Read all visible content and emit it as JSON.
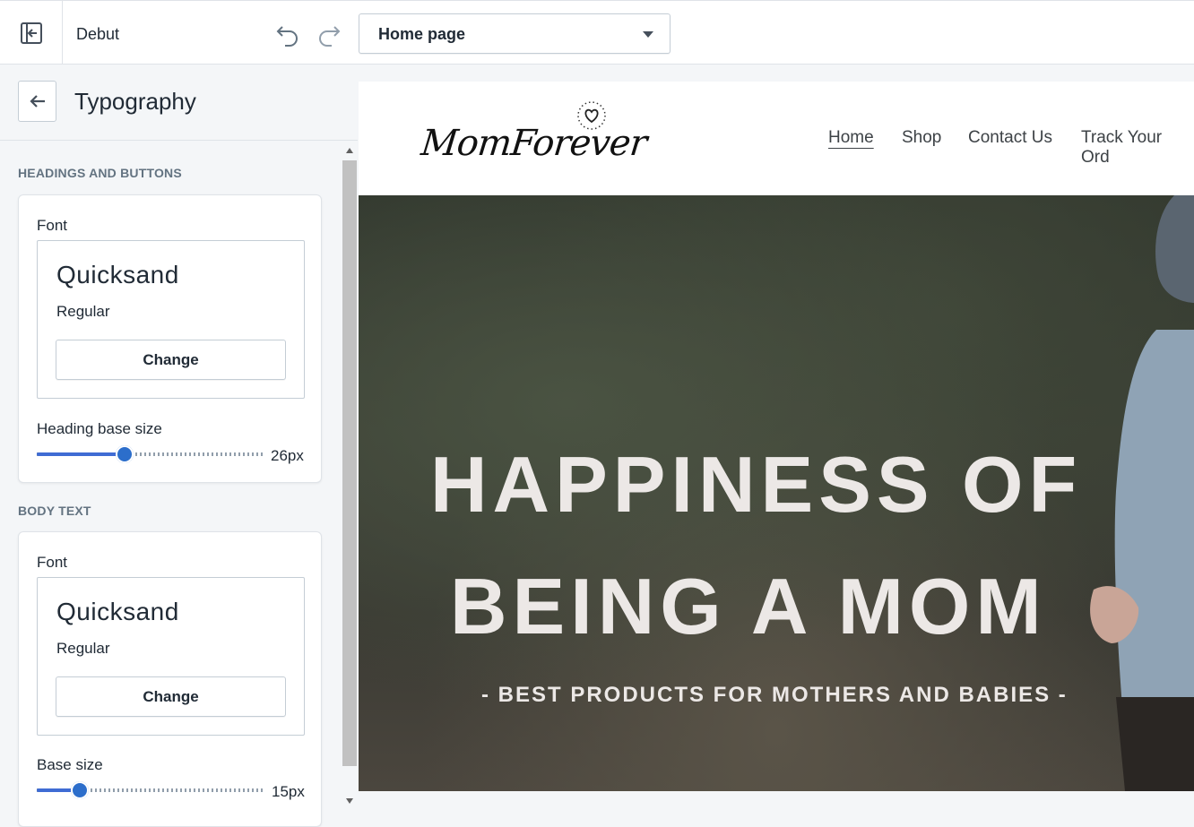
{
  "topbar": {
    "theme_name": "Debut",
    "page_select": {
      "value": "Home page"
    }
  },
  "sidebar": {
    "title": "Typography",
    "sections": [
      {
        "label": "HEADINGS AND BUTTONS",
        "font_label": "Font",
        "font_name": "Quicksand",
        "font_style": "Regular",
        "change_label": "Change",
        "size_label": "Heading base size",
        "size_value": "26px",
        "size_fraction": 0.39
      },
      {
        "label": "BODY TEXT",
        "font_label": "Font",
        "font_name": "Quicksand",
        "font_style": "Regular",
        "change_label": "Change",
        "size_label": "Base size",
        "size_value": "15px",
        "size_fraction": 0.19
      }
    ]
  },
  "preview": {
    "logo": "MomForever",
    "nav": [
      "Home",
      "Shop",
      "Contact Us",
      "Track Your Ord"
    ],
    "hero": {
      "line1": "HAPPINESS OF",
      "line2": "BEING A MOM",
      "subtitle": "- BEST PRODUCTS FOR MOTHERS AND BABIES -"
    }
  },
  "colors": {
    "accent": "#2c6ecb",
    "background": "#f4f6f8",
    "border": "#dfe3e8"
  }
}
